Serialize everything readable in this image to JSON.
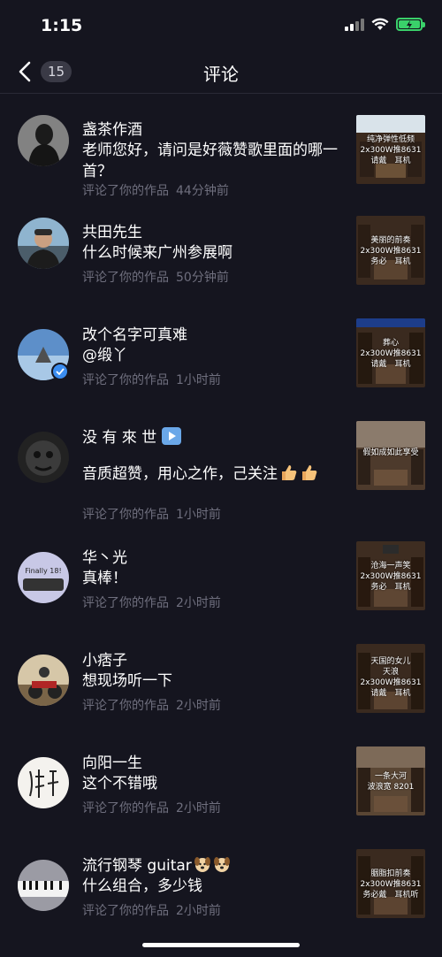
{
  "status_bar": {
    "time": "1:15"
  },
  "nav": {
    "back_count": "15",
    "title": "评论"
  },
  "comments": [
    {
      "name": "盏茶作酒",
      "content": "老师您好，请问是好薇赞歌里面的哪一首？",
      "action": "评论了你的作品",
      "time": "44分钟前",
      "thumb_caption": [
        "纯净弹性低频",
        "2x300W推8631",
        "请戴　耳机"
      ]
    },
    {
      "name": "共田先生",
      "content": "什么时候来广州参展啊",
      "action": "评论了你的作品",
      "time": "50分钟前",
      "thumb_caption": [
        "美丽的前奏",
        "2x300W推8631",
        "务必　耳机"
      ]
    },
    {
      "name": "改个名字可真难",
      "content": "@缎丫",
      "action": "评论了你的作品",
      "time": "1小时前",
      "thumb_caption": [
        "葬心",
        "2x300W推8631",
        "请戴　耳机"
      ]
    },
    {
      "name": "没 有 來 世",
      "content": "音质超赞，用心之作，己关注",
      "action": "评论了你的作品",
      "time": "1小时前",
      "thumb_caption": [
        "假如成如此享受"
      ]
    },
    {
      "name": "华丶光",
      "content": "真棒！",
      "action": "评论了你的作品",
      "time": "2小时前",
      "thumb_caption": [
        "沧海一声笑",
        "2x300W推8631",
        "务必　耳机"
      ]
    },
    {
      "name": "小痞子",
      "content": "想现场听一下",
      "action": "评论了你的作品",
      "time": "2小时前",
      "thumb_caption": [
        "天国的女儿",
        "天浪",
        "2x300W推8631",
        "请戴　耳机"
      ]
    },
    {
      "name": "向阳一生",
      "content": "这个不错哦",
      "action": "评论了你的作品",
      "time": "2小时前",
      "thumb_caption": [
        "一条大河",
        "波浪宽 8201"
      ]
    },
    {
      "name": "流行钢琴 guitar",
      "content": "什么组合，多少钱",
      "action": "评论了你的作品",
      "time": "2小时前",
      "thumb_caption": [
        "胭脂扣前奏",
        "2x300W推8631",
        "务必戴　耳机听"
      ]
    }
  ],
  "avatar_labels": {
    "huaguang": "Finally 18!"
  },
  "colors": {
    "background": "#15151f",
    "meta_text": "#6f6f7e",
    "battery": "#3ad16a",
    "verified": "#3b8df0"
  },
  "icons": [
    "back-chevron-icon",
    "signal-icon",
    "wifi-icon",
    "battery-icon",
    "verified-icon",
    "play-emoji-icon",
    "thumbs-up-emoji-icon",
    "dog-emoji-icon"
  ]
}
